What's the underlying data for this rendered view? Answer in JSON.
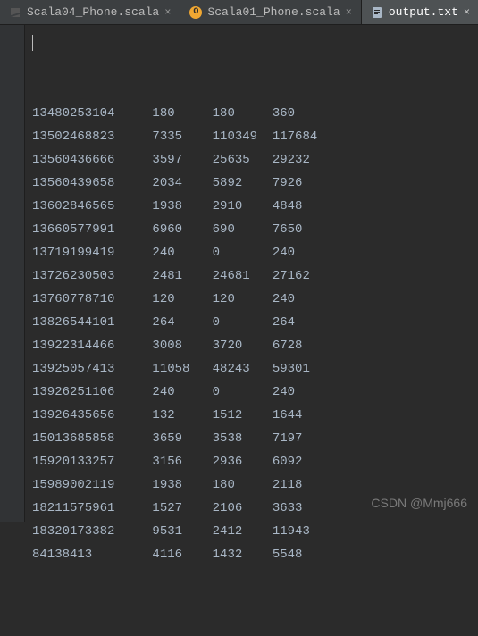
{
  "tabs": [
    {
      "label": "Scala04_Phone.scala",
      "icon": "scala-dark",
      "active": false
    },
    {
      "label": "Scala01_Phone.scala",
      "icon": "scala-orange",
      "active": false
    },
    {
      "label": "output.txt",
      "icon": "text-file",
      "active": true
    }
  ],
  "lines": [
    {
      "cols": [
        "13480253104",
        "180",
        "180",
        "360"
      ]
    },
    {
      "cols": [
        "13502468823",
        "7335",
        "110349",
        "117684"
      ]
    },
    {
      "cols": [
        "13560436666",
        "3597",
        "25635",
        "29232"
      ]
    },
    {
      "cols": [
        "13560439658",
        "2034",
        "5892",
        "7926"
      ]
    },
    {
      "cols": [
        "13602846565",
        "1938",
        "2910",
        "4848"
      ]
    },
    {
      "cols": [
        "13660577991",
        "6960",
        "690",
        "7650"
      ]
    },
    {
      "cols": [
        "13719199419",
        "240",
        "0",
        "240"
      ]
    },
    {
      "cols": [
        "13726230503",
        "2481",
        "24681",
        "27162"
      ]
    },
    {
      "cols": [
        "13760778710",
        "120",
        "120",
        "240"
      ]
    },
    {
      "cols": [
        "13826544101",
        "264",
        "0",
        "264"
      ]
    },
    {
      "cols": [
        "13922314466",
        "3008",
        "3720",
        "6728"
      ]
    },
    {
      "cols": [
        "13925057413",
        "11058",
        "48243",
        "59301"
      ]
    },
    {
      "cols": [
        "13926251106",
        "240",
        "0",
        "240"
      ]
    },
    {
      "cols": [
        "13926435656",
        "132",
        "1512",
        "1644"
      ]
    },
    {
      "cols": [
        "15013685858",
        "3659",
        "3538",
        "7197"
      ]
    },
    {
      "cols": [
        "15920133257",
        "3156",
        "2936",
        "6092"
      ]
    },
    {
      "cols": [
        "15989002119",
        "1938",
        "180",
        "2118"
      ]
    },
    {
      "cols": [
        "18211575961",
        "1527",
        "2106",
        "3633"
      ]
    },
    {
      "cols": [
        "18320173382",
        "9531",
        "2412",
        "11943"
      ]
    },
    {
      "cols": [
        "84138413",
        "4116",
        "1432",
        "5548"
      ]
    }
  ],
  "watermark": "CSDN @Mmj666",
  "close_glyph": "×"
}
